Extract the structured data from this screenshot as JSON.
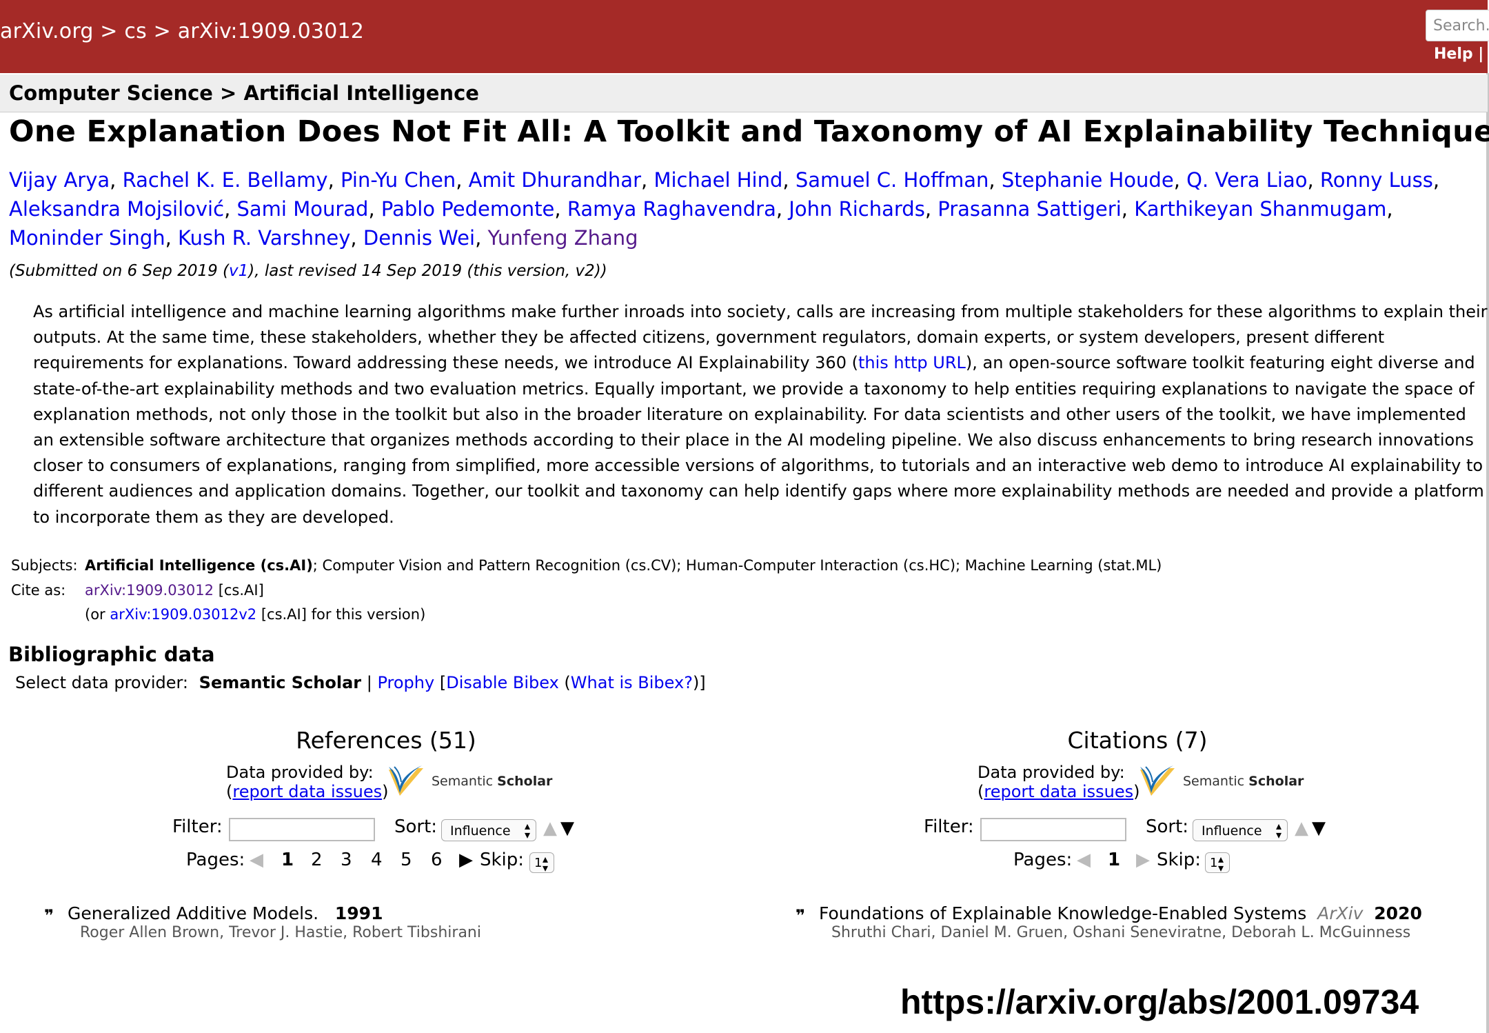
{
  "header": {
    "breadcrumb": "arXiv.org > cs > arXiv:1909.03012",
    "search_placeholder": "Search...",
    "help_links": "Help | A"
  },
  "subheader": "Computer Science > Artificial Intelligence",
  "paper": {
    "title": "One Explanation Does Not Fit All: A Toolkit and Taxonomy of AI Explainability Techniques",
    "authors": [
      "Vijay Arya",
      "Rachel K. E. Bellamy",
      "Pin-Yu Chen",
      "Amit Dhurandhar",
      "Michael Hind",
      "Samuel C. Hoffman",
      "Stephanie Houde",
      "Q. Vera Liao",
      "Ronny Luss",
      "Aleksandra Mojsilović",
      "Sami Mourad",
      "Pablo Pedemonte",
      "Ramya Raghavendra",
      "John Richards",
      "Prasanna Sattigeri",
      "Karthikeyan Shanmugam",
      "Moninder Singh",
      "Kush R. Varshney",
      "Dennis Wei",
      "Yunfeng Zhang"
    ],
    "dateline": {
      "pre": "(Submitted on 6 Sep 2019 (",
      "v1": "v1",
      "post": "), last revised 14 Sep 2019 (this version, v2))"
    },
    "abstract": {
      "part1": "As artificial intelligence and machine learning algorithms make further inroads into society, calls are increasing from multiple stakeholders for these algorithms to explain their outputs. At the same time, these stakeholders, whether they be affected citizens, government regulators, domain experts, or system developers, present different requirements for explanations. Toward addressing these needs, we introduce AI Explainability 360 (",
      "link": "this http URL",
      "part2": "), an open-source software toolkit featuring eight diverse and state-of-the-art explainability methods and two evaluation metrics. Equally important, we provide a taxonomy to help entities requiring explanations to navigate the space of explanation methods, not only those in the toolkit but also in the broader literature on explainability. For data scientists and other users of the toolkit, we have implemented an extensible software architecture that organizes methods according to their place in the AI modeling pipeline. We also discuss enhancements to bring research innovations closer to consumers of explanations, ranging from simplified, more accessible versions of algorithms, to tutorials and an interactive web demo to introduce AI explainability to different audiences and application domains. Together, our toolkit and taxonomy can help identify gaps where more explainability methods are needed and provide a platform to incorporate them as they are developed."
    }
  },
  "meta": {
    "subjects_label": "Subjects:",
    "subjects_primary": "Artificial Intelligence (cs.AI)",
    "subjects_rest": "; Computer Vision and Pattern Recognition (cs.CV); Human-Computer Interaction (cs.HC); Machine Learning (stat.ML)",
    "cite_label": "Cite as:",
    "cite_id": "arXiv:1909.03012",
    "cite_cat": " [cs.AI]",
    "cite_alt_pre": "(or ",
    "cite_alt_id": "arXiv:1909.03012v2",
    "cite_alt_post": " [cs.AI] for this version)"
  },
  "biblio": {
    "title": "Bibliographic data",
    "select_label": "Select data provider: ",
    "semantic_scholar": "Semantic Scholar",
    "sep": " | ",
    "prophy": "Prophy",
    "disable_pre": "  [",
    "disable": "Disable Bibex",
    "what_pre": " (",
    "what": "What is Bibex?",
    "what_post": ")]"
  },
  "references": {
    "title": "References (51)",
    "provided_by": "Data provided by:",
    "report_pre": "(",
    "report": "report data issues",
    "report_post": ")",
    "logo_text_light": "Semantic ",
    "logo_text_bold": "Scholar",
    "filter_label": "Filter:",
    "sort_label": "Sort:",
    "sort_value": "Influence",
    "pages_label": "Pages:",
    "pages": [
      "1",
      "2",
      "3",
      "4",
      "5",
      "6"
    ],
    "skip_label": "Skip:",
    "skip_value": "1",
    "entry": {
      "title": "Generalized Additive Models.",
      "year": "1991",
      "authors": "Roger Allen Brown,  Trevor J. Hastie,  Robert Tibshirani"
    }
  },
  "citations": {
    "title": "Citations (7)",
    "provided_by": "Data provided by:",
    "report_pre": "(",
    "report": "report data issues",
    "report_post": ")",
    "logo_text_light": "Semantic ",
    "logo_text_bold": "Scholar",
    "filter_label": "Filter:",
    "sort_label": "Sort:",
    "sort_value": "Influence",
    "pages_label": "Pages:",
    "pages": [
      "1"
    ],
    "skip_label": "Skip:",
    "skip_value": "1",
    "entry": {
      "title": "Foundations of Explainable Knowledge-Enabled Systems",
      "venue": "ArXiv",
      "year": "2020",
      "authors": "Shruthi Chari,  Daniel M. Gruen,  Oshani Seneviratne,  Deborah L. McGuinness"
    }
  },
  "footer_url": "https://arxiv.org/abs/2001.09734",
  "colors": {
    "header_bg": "#a52a27",
    "link": "#0000ee",
    "visited": "#551a8b"
  }
}
